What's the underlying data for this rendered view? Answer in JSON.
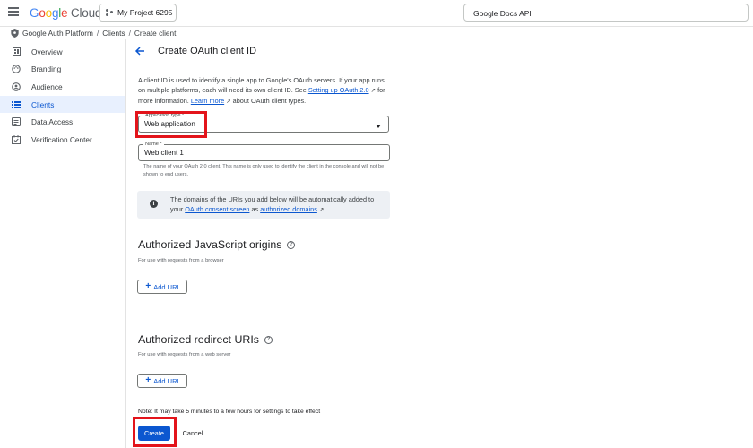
{
  "header": {
    "logo": [
      "G",
      "o",
      "o",
      "g",
      "l",
      "e",
      " Cloud"
    ],
    "project": "My Project 6295",
    "search_value": "Google Docs API"
  },
  "breadcrumb": [
    "Google Auth Platform",
    "Clients",
    "Create client"
  ],
  "sidebar": {
    "items": [
      {
        "label": "Overview",
        "icon": "overview-icon"
      },
      {
        "label": "Branding",
        "icon": "palette-icon"
      },
      {
        "label": "Audience",
        "icon": "audience-icon"
      },
      {
        "label": "Clients",
        "icon": "key-icon",
        "active": true
      },
      {
        "label": "Data Access",
        "icon": "data-access-icon"
      },
      {
        "label": "Verification Center",
        "icon": "verification-icon"
      }
    ]
  },
  "main": {
    "title": "Create OAuth client ID",
    "intro_1": "A client ID is used to identify a single app to Google's OAuth servers. If your app runs on multiple platforms, each will need its own client ID. See ",
    "intro_link_1": "Setting up OAuth 2.0",
    "intro_2": " for more information. ",
    "intro_link_2": "Learn more",
    "intro_3": " about OAuth client types.",
    "app_type": {
      "label": "Application type *",
      "value": "Web application"
    },
    "name": {
      "label": "Name *",
      "value": "Web client 1",
      "helper": "The name of your OAuth 2.0 client. This name is only used to identify the client in the console and will not be shown to end users."
    },
    "info": {
      "text_1": "The domains of the URIs you add below will be automatically added to your ",
      "link_1": "OAuth consent screen",
      "text_2": " as ",
      "link_2": "authorized domains",
      "text_3": "."
    },
    "js_origins": {
      "title": "Authorized JavaScript origins",
      "subtitle": "For use with requests from a browser",
      "button": "Add URI"
    },
    "redirect_uris": {
      "title": "Authorized redirect URIs",
      "subtitle": "For use with requests from a web server",
      "button": "Add URI"
    },
    "note": "Note: It may take 5 minutes to a few hours for settings to take effect",
    "create_label": "Create",
    "cancel_label": "Cancel"
  },
  "colors": {
    "accent": "#0b57d0",
    "highlight": "#e3141b",
    "active_nav_bg": "#e8f0fe"
  }
}
